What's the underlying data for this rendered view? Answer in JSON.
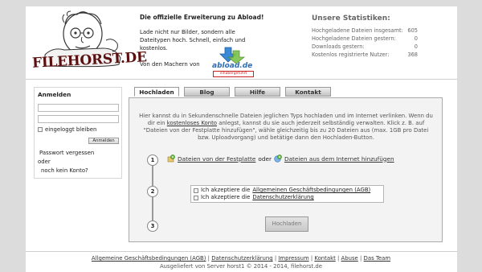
{
  "header": {
    "logo_text": "FILEHORST.DE",
    "promo_title": "Die offizielle Erweiterung zu Abload!",
    "promo_body": "Lade nicht nur Bilder, sondern alle Dateitypen hoch. Schnell, einfach und kostenlos.",
    "promo_by": "Von den Machern von",
    "abload_logo": "abload.de",
    "abload_badge": "inhabergeführt"
  },
  "stats": {
    "title": "Unsere Statistiken:",
    "rows": [
      {
        "label": "Hochgeladene Dateien insgesamt:",
        "value": "605"
      },
      {
        "label": "Hochgeladene Dateien gestern:",
        "value": "0"
      },
      {
        "label": "Downloads gestern:",
        "value": "0"
      },
      {
        "label": "Kostenlos registrierte Nutzer:",
        "value": "368"
      }
    ]
  },
  "login": {
    "title": "Anmelden",
    "username_value": "",
    "password_value": "",
    "remember_label": "eingeloggt bleiben",
    "submit_label": "Anmelden",
    "forgot_label": "Passwort vergessen",
    "or_label": "oder",
    "no_account_label": "noch kein Konto?"
  },
  "tabs": [
    {
      "label": "Hochladen"
    },
    {
      "label": "Blog"
    },
    {
      "label": "Hilfe"
    },
    {
      "label": "Kontakt"
    }
  ],
  "upload": {
    "intro_part1": "Hier kannst du in Sekundenschnelle Dateien jeglichen Typs hochladen und im Internet verlinken. Wenn du dir ein",
    "intro_link": "kostenloses Konto",
    "intro_part2": "anlegst, kannst du sie auch jederzeit selbständig verwalten. Klick z. B. auf \"Dateien von der Festplatte hinzufügen\", wähle gleichzeitig bis zu 20 Dateien aus (max. 1GB pro Datei bzw. Uploadvorgang) und betätige dann den Hochladen-Button.",
    "step1_num": "1",
    "step1_local": "Dateien von der Festplatte",
    "step1_or": "oder",
    "step1_remote": "Dateien aus dem Internet hinzufügen",
    "step2_num": "2",
    "agb_prefix": "Ich akzeptiere die",
    "agb_link": "Allgemeinen Geschäftsbedingungen (AGB)",
    "privacy_prefix": "Ich akzeptiere die",
    "privacy_link": "Datenschutzerklärung",
    "step3_num": "3",
    "upload_button": "Hochladen"
  },
  "footer": {
    "links": [
      "Allgemeine Geschäftsbedingungen (AGB)",
      "Datenschutzerklärung",
      "Impressum",
      "Kontakt",
      "Abuse",
      "Das Team"
    ],
    "separator": "|",
    "copyright": "Ausgeliefert von Server horst1 © 2014 - 2014, filehorst.de"
  },
  "colors": {
    "background": "#dcdcdc",
    "logo_red": "#5a1010",
    "abload_blue": "#2f6db5",
    "badge_red": "#cc2222"
  }
}
